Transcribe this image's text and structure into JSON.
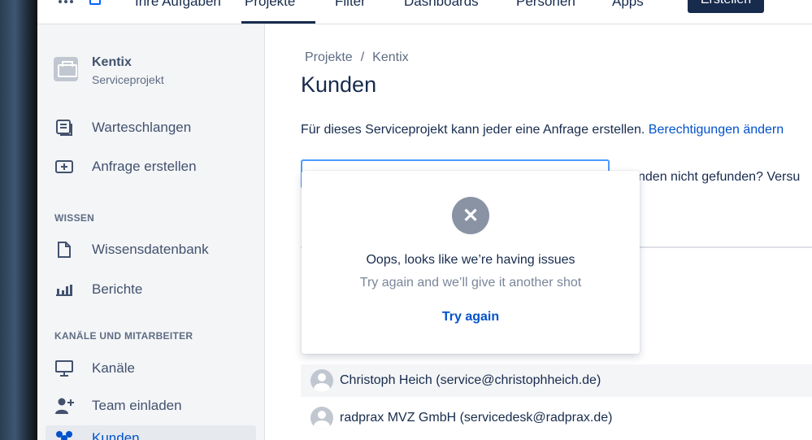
{
  "topnav": {
    "items": [
      "Ihre Aufgaben",
      "Projekte",
      "Filter",
      "Dashboards",
      "Personen",
      "Apps"
    ],
    "active": "Projekte",
    "create_label": "Erstellen"
  },
  "sidebar": {
    "project_name": "Kentix",
    "project_type": "Serviceprojekt",
    "items": [
      {
        "label": "Warteschlangen",
        "icon": "queues-icon"
      },
      {
        "label": "Anfrage erstellen",
        "icon": "create-request-icon"
      }
    ],
    "section_wissen": "WISSEN",
    "wissen_items": [
      {
        "label": "Wissensdatenbank",
        "icon": "document-icon"
      },
      {
        "label": "Berichte",
        "icon": "reports-icon"
      }
    ],
    "section_kanaele": "KANÄLE UND MITARBEITER",
    "kanaele_items": [
      {
        "label": "Kanäle",
        "icon": "monitor-icon"
      },
      {
        "label": "Team einladen",
        "icon": "add-person-icon"
      },
      {
        "label": "Kunden",
        "icon": "customers-icon"
      }
    ]
  },
  "main": {
    "breadcrumb_1": "Projekte",
    "breadcrumb_sep": "/",
    "breadcrumb_2": "Kentix",
    "title": "Kunden",
    "info_text": "Für dieses Serviceprojekt kann jeder eine Anfrage erstellen.",
    "info_link": "Berechtigungen ändern",
    "hint_text": "nden nicht gefunden? Versu",
    "customers": [
      "Christoph Heich (service@christophheich.de)",
      "radprax MVZ GmbH (servicedesk@radprax.de)"
    ]
  },
  "popup": {
    "title": "Oops, looks like we’re having issues",
    "subtitle": "Try again and we’ll give it another shot",
    "retry_label": "Try again",
    "icon": "error-x-icon"
  }
}
